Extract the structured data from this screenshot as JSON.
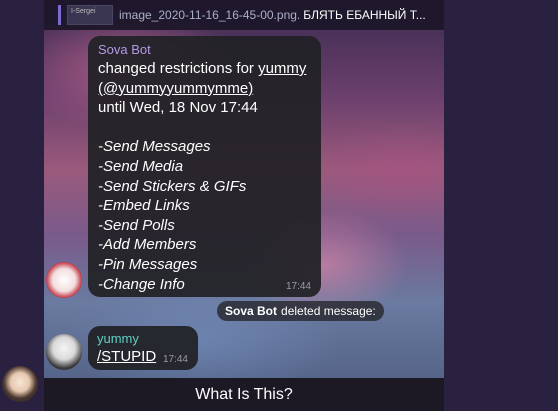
{
  "reply_preview": {
    "thumb_label": "I-Sergei",
    "file_name": "image_2020-11-16_16-45-00.png.",
    "text": "БЛЯТЬ ЕБАННЫЙ Т..."
  },
  "bot_message": {
    "sender": "Sova Bot",
    "line1_prefix": "changed restrictions for ",
    "line1_link": "yummy",
    "line2": "(@yummyyummymme)",
    "line3": "until Wed, 18 Nov 17:44",
    "restrictions": [
      "-Send Messages",
      "-Send Media",
      "-Send Stickers & GIFs",
      "-Embed Links",
      "-Send Polls",
      "-Add Members",
      "-Pin Messages",
      "-Change Info"
    ],
    "time": "17:44"
  },
  "service_message": {
    "actor": "Sova Bot",
    "text": "deleted message:"
  },
  "user_message": {
    "sender": "yummy",
    "text": "/STUPID",
    "time": "17:44"
  },
  "bottom_bar": {
    "label": "What Is This?"
  },
  "colors": {
    "bot_sender": "#b39ae8",
    "user_sender": "#5fd0c0",
    "sidebar": "#2a2140"
  }
}
